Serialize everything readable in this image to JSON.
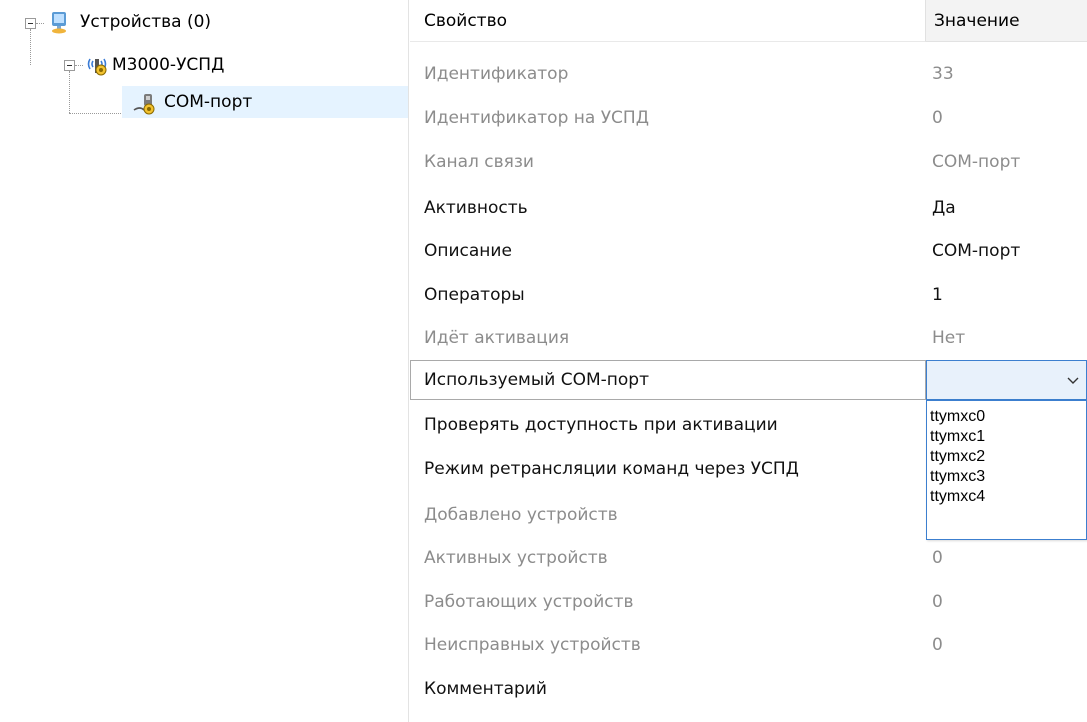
{
  "tree": {
    "root_label": "Устройства (0)",
    "device_label": "M3000-УСПД",
    "port_label": "COM-порт"
  },
  "grid": {
    "header": {
      "property": "Свойство",
      "value": "Значение"
    },
    "rows": [
      {
        "name": "Идентификатор",
        "value": "33",
        "readonly": true
      },
      {
        "name": "Идентификатор на УСПД",
        "value": "0",
        "readonly": true
      },
      {
        "name": "Канал связи",
        "value": "COM-порт",
        "readonly": true
      },
      {
        "name": "Активность",
        "value": "Да",
        "readonly": false
      },
      {
        "name": "Описание",
        "value": "COM-порт",
        "readonly": false
      },
      {
        "name": "Операторы",
        "value": "1",
        "readonly": false
      },
      {
        "name": "Идёт активация",
        "value": "Нет",
        "readonly": true
      }
    ],
    "editing_row": {
      "name": "Используемый COM-порт",
      "value": ""
    },
    "rows_after": [
      {
        "name": "Проверять доступность при активации",
        "value": "",
        "readonly": false
      },
      {
        "name": "Режим ретрансляции команд через УСПД",
        "value": "",
        "readonly": false
      },
      {
        "name": "Добавлено устройств",
        "value": "",
        "readonly": true
      },
      {
        "name": "Активных устройств",
        "value": "0",
        "readonly": true
      },
      {
        "name": "Работающих устройств",
        "value": "0",
        "readonly": true
      },
      {
        "name": "Неисправных устройств",
        "value": "0",
        "readonly": true
      },
      {
        "name": "Комментарий",
        "value": "",
        "readonly": false
      }
    ],
    "dropdown_options": [
      "ttymxc0",
      "ttymxc1",
      "ttymxc2",
      "ttymxc3",
      "ttymxc4"
    ]
  },
  "colors": {
    "readonly_text": "#8c8c8c",
    "normal_text": "#111111",
    "selection_bg": "#e5f3ff",
    "focus_border": "#3c7fcf",
    "combo_bg": "#e8f1fb"
  },
  "icons": {
    "root": "computer-network-icon",
    "device": "radio-device-icon",
    "port": "com-port-icon",
    "combo": "chevron-down-icon"
  }
}
